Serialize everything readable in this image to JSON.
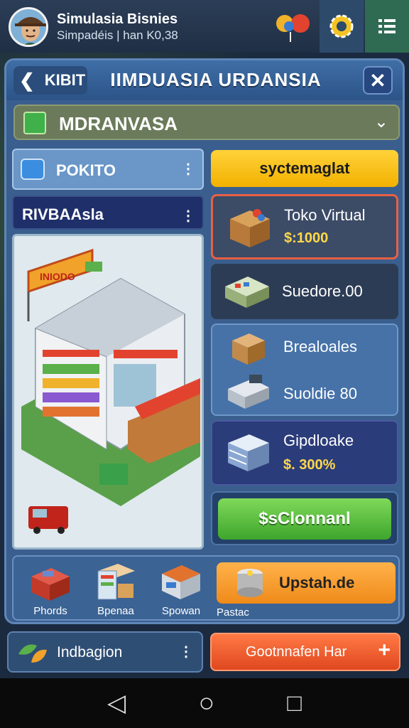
{
  "player": {
    "name": "Simulasia Bisnies",
    "subtitle": "Simpadéis | han K0,38"
  },
  "header": {
    "back_label": "KIBIT",
    "title": "IIMDUASIA URDANSIA",
    "close_label": "✕"
  },
  "category": {
    "label": "MDRANVASA",
    "chevron": "⌄"
  },
  "left_tabs": [
    {
      "label": "POKITO",
      "more": "⋮"
    },
    {
      "label": "RIVBAAsla",
      "more": "⋮"
    }
  ],
  "store_sign": "INIODO",
  "top_button": "syctemaglat",
  "items": [
    {
      "name": "Toko Virtual",
      "price": "$:1000",
      "icon": "box-icon"
    },
    {
      "name": "Suedore.00",
      "price": "",
      "icon": "shelf-box-icon"
    },
    {
      "name": "Brealoales",
      "price": "",
      "icon": "package-icon"
    },
    {
      "name": "Suoldie 80",
      "price": "",
      "icon": "cash-register-icon"
    },
    {
      "name": "Gipdloake",
      "price": "$. 300%",
      "icon": "server-icon"
    }
  ],
  "confirm_button": "$sClonnanl",
  "shelf": [
    {
      "label": "Phords",
      "icon": "product-box-icon"
    },
    {
      "label": "Bpenaa",
      "icon": "shelves-icon"
    },
    {
      "label": "Spowan",
      "icon": "store-icon"
    },
    {
      "label": "Pastac",
      "icon": "upgrade-icon"
    }
  ],
  "upgrade_button": "Upstah.de",
  "bottom_left": {
    "label": "Indbagion",
    "more": "⋮"
  },
  "bottom_right": {
    "label": "Gootnnafen Har",
    "plus": "+"
  },
  "nav": {
    "back": "◁",
    "home": "○",
    "recent": "□"
  },
  "colors": {
    "accent_yellow": "#f2b100",
    "accent_green": "#3ea52c",
    "accent_orange": "#ef8a1a"
  }
}
